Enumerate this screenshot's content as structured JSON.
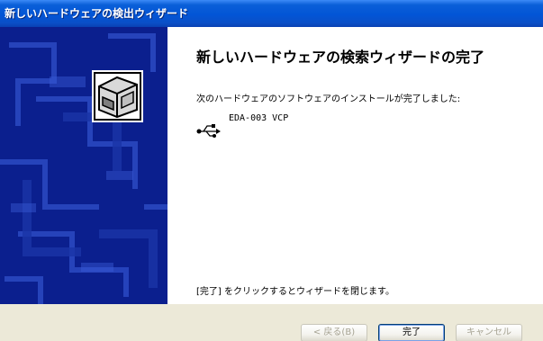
{
  "window": {
    "title": "新しいハードウェアの検出ウィザード"
  },
  "wizard": {
    "heading": "新しいハードウェアの検索ウィザードの完了",
    "description": "次のハードウェアのソフトウェアのインストールが完了しました:",
    "device": {
      "icon": "usb-icon",
      "name": "EDA-003 VCP"
    },
    "footer": "[完了] をクリックするとウィザードを閉じます。",
    "side_icon": "hardware-box-icon"
  },
  "buttons": {
    "back": "< 戻る(B)",
    "finish": "完了",
    "cancel": "キャンセル"
  },
  "colors": {
    "titlebar": "#0255d6",
    "side_panel": "#0b1f8e",
    "content_bg": "#ffffff",
    "dialog_bg": "#ece9d8"
  }
}
